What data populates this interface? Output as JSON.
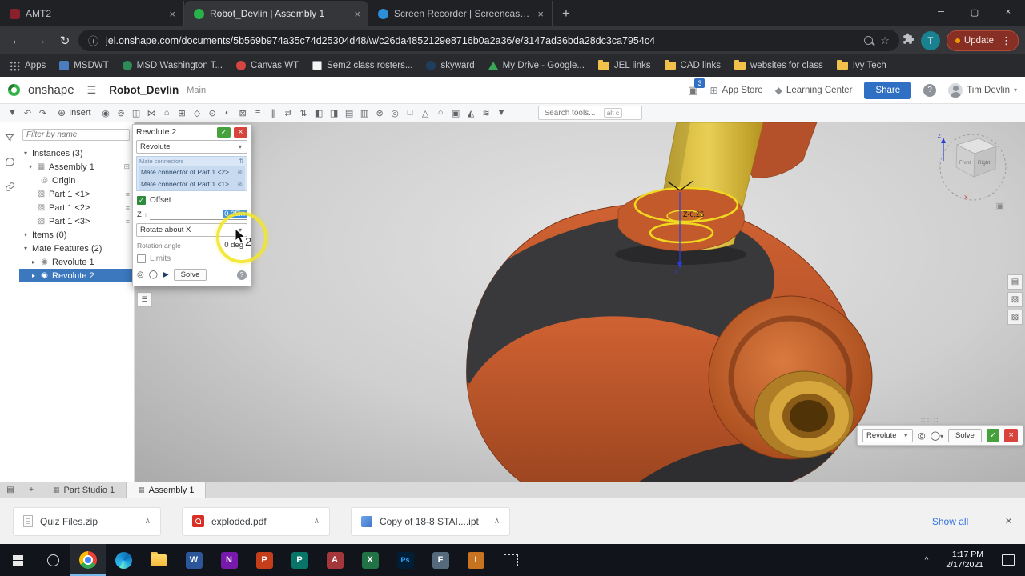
{
  "browser": {
    "tabs": [
      {
        "title": "AMT2"
      },
      {
        "title": "Robot_Devlin | Assembly 1"
      },
      {
        "title": "Screen Recorder | Screencast-O-..."
      }
    ],
    "url": "jel.onshape.com/documents/5b569b974a35c74d25304d48/w/c26da4852129e8716b0a2a36/e/3147ad36bda28dc3ca7954c4",
    "update_button": "Update",
    "profile_initial": "T",
    "bookmarks": [
      {
        "label": "Apps"
      },
      {
        "label": "MSDWT"
      },
      {
        "label": "MSD Washington T..."
      },
      {
        "label": "Canvas WT"
      },
      {
        "label": "Sem2 class rosters..."
      },
      {
        "label": "skyward"
      },
      {
        "label": "My Drive - Google..."
      },
      {
        "label": "JEL links"
      },
      {
        "label": "CAD links"
      },
      {
        "label": "websites for class"
      },
      {
        "label": "Ivy Tech"
      }
    ]
  },
  "onshape": {
    "logo_text": "onshape",
    "document_title": "Robot_Devlin",
    "workspace_label": "Main",
    "notification_badge": "3",
    "app_store_label": "App Store",
    "learning_center_label": "Learning Center",
    "share_label": "Share",
    "user_name": "Tim Devlin",
    "toolbar": {
      "insert_label": "Insert",
      "search_placeholder": "Search tools...",
      "search_shortcut": "alt c",
      "icons_left": [
        "▼",
        "↶",
        "↷"
      ],
      "icons_main": [
        "◉",
        "⊚",
        "◫",
        "⋈",
        "⌂",
        "⊞",
        "◇",
        "⊙",
        "◐",
        "⊠",
        "≡",
        "∥",
        "⇄",
        "⇅",
        "◧",
        "◨",
        "▤",
        "▥",
        "⊗",
        "◎",
        "□",
        "△",
        "○",
        "▣",
        "◭",
        "≋",
        "▼"
      ]
    },
    "left_panel": {
      "filter_placeholder": "Filter by name",
      "instances_header": "Instances (3)",
      "assembly_label": "Assembly 1",
      "origin_label": "Origin",
      "parts": [
        "Part 1 <1>",
        "Part 1 <2>",
        "Part 1 <3>"
      ],
      "items_header": "Items (0)",
      "mate_features_header": "Mate Features (2)",
      "mate_features": [
        "Revolute 1",
        "Revolute 2"
      ]
    },
    "dialog": {
      "title": "Revolute 2",
      "type_value": "Revolute",
      "connectors_header": "Mate connectors",
      "connectors": [
        "Mate connector of Part 1 <2>",
        "Mate connector of Part 1 <1>"
      ],
      "offset_label": "Offset",
      "z_label": "Z",
      "z_value": "0.25in",
      "rotate_value": "Rotate about X",
      "rotation_angle_label": "Rotation angle",
      "rotation_angle_value": "0 deg",
      "limits_label": "Limits",
      "solve_label": "Solve"
    },
    "viewport": {
      "offset_callout": "Z-0.25",
      "axis_z": "z",
      "annotation_step": "2",
      "viewcube": {
        "right": "Right",
        "front": "Front",
        "z": "Z",
        "x": "X"
      }
    },
    "mini_toolbar": {
      "type_value": "Revolute",
      "solve_label": "Solve"
    },
    "bottom_tabs": [
      {
        "label": "Part Studio 1"
      },
      {
        "label": "Assembly 1"
      }
    ]
  },
  "downloads": {
    "items": [
      {
        "name": "Quiz Files.zip"
      },
      {
        "name": "exploded.pdf"
      },
      {
        "name": "Copy of 18-8 STAI....ipt"
      }
    ],
    "show_all": "Show all"
  },
  "taskbar": {
    "time": "1:17 PM",
    "date": "2/17/2021",
    "apps": [
      {
        "letter": ""
      },
      {
        "letter": ""
      },
      {
        "letter": "W"
      },
      {
        "letter": "N"
      },
      {
        "letter": "P"
      },
      {
        "letter": "P"
      },
      {
        "letter": "A"
      },
      {
        "letter": "X"
      },
      {
        "letter": "Ps"
      },
      {
        "letter": "F"
      },
      {
        "letter": "I"
      },
      {
        "letter": ""
      }
    ]
  }
}
